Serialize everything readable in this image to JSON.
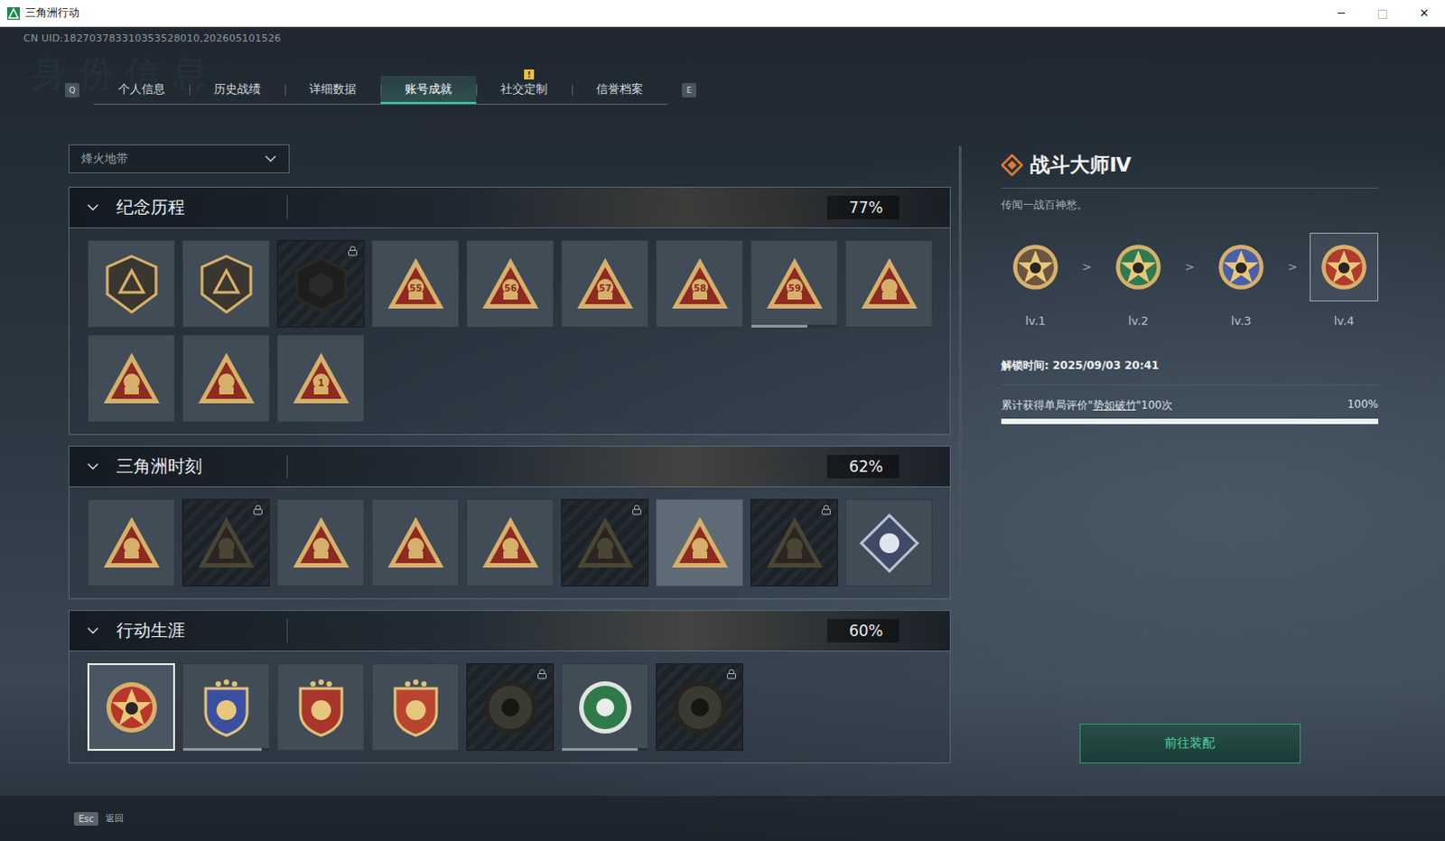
{
  "window": {
    "title": "三角洲行动",
    "controls": [
      "─",
      "□",
      "✕"
    ]
  },
  "uid": "CN UID:182703783310353528010,202605101526",
  "watermark": "身份信息",
  "tabs": {
    "prev_key": "Q",
    "next_key": "E",
    "items": [
      {
        "label": "个人信息",
        "selected": false,
        "badge": ""
      },
      {
        "label": "历史战绩",
        "selected": false,
        "badge": ""
      },
      {
        "label": "详细数据",
        "selected": false,
        "badge": ""
      },
      {
        "label": "账号成就",
        "selected": true,
        "badge": ""
      },
      {
        "label": "社交定制",
        "selected": false,
        "badge": "!"
      },
      {
        "label": "信誉档案",
        "selected": false,
        "badge": ""
      }
    ]
  },
  "mode_select": {
    "value": "烽火地带"
  },
  "sections": [
    {
      "title": "纪念历程",
      "percent": "77%",
      "expanded": true,
      "badges": [
        {
          "kind": "shield",
          "locked": false,
          "selected": false,
          "highlighted": false,
          "mark": ""
        },
        {
          "kind": "shield",
          "locked": false,
          "selected": false,
          "highlighted": false,
          "mark": ""
        },
        {
          "kind": "hex",
          "locked": true,
          "selected": false,
          "highlighted": false,
          "mark": ""
        },
        {
          "kind": "tri",
          "locked": false,
          "selected": false,
          "highlighted": false,
          "mark": "55"
        },
        {
          "kind": "tri",
          "locked": false,
          "selected": false,
          "highlighted": false,
          "mark": "56"
        },
        {
          "kind": "tri",
          "locked": false,
          "selected": false,
          "highlighted": false,
          "mark": "57"
        },
        {
          "kind": "tri",
          "locked": false,
          "selected": false,
          "highlighted": false,
          "mark": "58"
        },
        {
          "kind": "tri",
          "locked": false,
          "selected": false,
          "highlighted": false,
          "mark": "59",
          "level": 0.65
        },
        {
          "kind": "tri",
          "locked": false,
          "selected": false,
          "highlighted": false,
          "mark": ""
        },
        {
          "kind": "tri",
          "locked": false,
          "selected": false,
          "highlighted": false,
          "mark": ""
        },
        {
          "kind": "tri",
          "locked": false,
          "selected": false,
          "highlighted": false,
          "mark": ""
        },
        {
          "kind": "tri",
          "locked": false,
          "selected": false,
          "highlighted": false,
          "mark": "1"
        }
      ]
    },
    {
      "title": "三角洲时刻",
      "percent": "62%",
      "expanded": true,
      "badges": [
        {
          "kind": "tri",
          "locked": false,
          "selected": false,
          "highlighted": false,
          "mark": ""
        },
        {
          "kind": "tri",
          "locked": true,
          "selected": false,
          "highlighted": false,
          "mark": ""
        },
        {
          "kind": "tri",
          "locked": false,
          "selected": false,
          "highlighted": false,
          "mark": ""
        },
        {
          "kind": "tri",
          "locked": false,
          "selected": false,
          "highlighted": false,
          "mark": ""
        },
        {
          "kind": "tri",
          "locked": false,
          "selected": false,
          "highlighted": false,
          "mark": ""
        },
        {
          "kind": "tri",
          "locked": true,
          "selected": false,
          "highlighted": false,
          "mark": ""
        },
        {
          "kind": "tri",
          "locked": false,
          "selected": false,
          "highlighted": true,
          "mark": ""
        },
        {
          "kind": "tri",
          "locked": true,
          "selected": false,
          "highlighted": false,
          "mark": ""
        },
        {
          "kind": "diamond",
          "locked": false,
          "selected": false,
          "highlighted": false,
          "mark": ""
        }
      ]
    },
    {
      "title": "行动生涯",
      "percent": "60%",
      "expanded": true,
      "badges": [
        {
          "kind": "medal",
          "locked": false,
          "selected": true,
          "highlighted": false,
          "mark": "",
          "color": "#b8352a"
        },
        {
          "kind": "crest",
          "locked": false,
          "selected": false,
          "highlighted": false,
          "mark": "",
          "color": "#3a4fa0",
          "level": 0.92
        },
        {
          "kind": "crest",
          "locked": false,
          "selected": false,
          "highlighted": false,
          "mark": "",
          "color": "#a8362c"
        },
        {
          "kind": "crest",
          "locked": false,
          "selected": false,
          "highlighted": false,
          "mark": "",
          "color": "#b8452f"
        },
        {
          "kind": "round",
          "locked": true,
          "selected": false,
          "highlighted": false,
          "mark": "",
          "color": "#3a3a32"
        },
        {
          "kind": "round",
          "locked": false,
          "selected": false,
          "highlighted": false,
          "mark": "",
          "color": "#2e7a4a",
          "level": 0.88
        },
        {
          "kind": "round",
          "locked": true,
          "selected": false,
          "highlighted": false,
          "mark": "",
          "color": "#3a3a32"
        }
      ]
    }
  ],
  "detail": {
    "title": "战斗大师Ⅳ",
    "subtitle": "传闻一战百神愁。",
    "separator": ">",
    "levels": [
      {
        "label": "lv.1",
        "selected": false,
        "color": "#6b5440"
      },
      {
        "label": "lv.2",
        "selected": false,
        "color": "#2f7a50"
      },
      {
        "label": "lv.3",
        "selected": false,
        "color": "#4a5fa8"
      },
      {
        "label": "lv.4",
        "selected": true,
        "color": "#b03a2e"
      }
    ],
    "unlock": "解锁时间: 2025/09/03 20:41",
    "requirement": {
      "prefix": "累计获得单局评价\"",
      "keyword": "势如破竹",
      "suffix": "\"100次"
    },
    "percent": "100%",
    "level": 1,
    "button": "前往装配"
  },
  "footer": {
    "key": "Esc",
    "label": "返回"
  }
}
